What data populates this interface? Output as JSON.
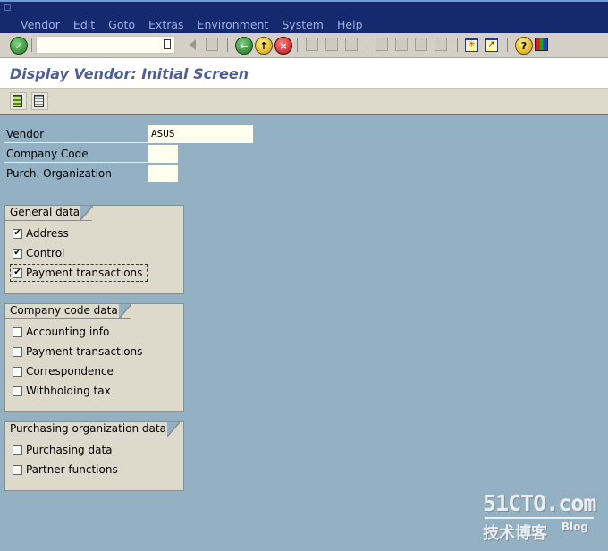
{
  "menubar": {
    "items": [
      "Vendor",
      "Edit",
      "Goto",
      "Extras",
      "Environment",
      "System",
      "Help"
    ]
  },
  "toolbar": {
    "command_field_value": "",
    "icons": [
      "enter-icon",
      "back-arrow-icon",
      "save-icon",
      "back-icon",
      "exit-icon",
      "cancel-icon",
      "print-icon",
      "find-icon",
      "find-next-icon",
      "first-page-icon",
      "previous-page-icon",
      "next-page-icon",
      "last-page-icon",
      "create-session-icon",
      "create-shortcut-icon",
      "help-icon",
      "layout-menu-icon"
    ]
  },
  "title": "Display Vendor:  Initial Screen",
  "app_toolbar": {
    "buttons": [
      "select-all-icon",
      "deselect-all-icon"
    ]
  },
  "fields": [
    {
      "label": "Vendor",
      "value": "ASUS"
    },
    {
      "label": "Company Code",
      "value": ""
    },
    {
      "label": "Purch. Organization",
      "value": ""
    }
  ],
  "groups": [
    {
      "title": "General data",
      "items": [
        {
          "label": "Address",
          "checked": true
        },
        {
          "label": "Control",
          "checked": true
        },
        {
          "label": "Payment transactions",
          "checked": true
        }
      ]
    },
    {
      "title": "Company code data",
      "items": [
        {
          "label": "Accounting info",
          "checked": false
        },
        {
          "label": "Payment transactions",
          "checked": false
        },
        {
          "label": "Correspondence",
          "checked": false
        },
        {
          "label": "Withholding tax",
          "checked": false
        }
      ]
    },
    {
      "title": "Purchasing organization data",
      "items": [
        {
          "label": "Purchasing data",
          "checked": false
        },
        {
          "label": "Partner functions",
          "checked": false
        }
      ]
    }
  ],
  "watermark": {
    "line1": "51CTO.com",
    "line2": "技术博客",
    "line3": "Blog"
  }
}
